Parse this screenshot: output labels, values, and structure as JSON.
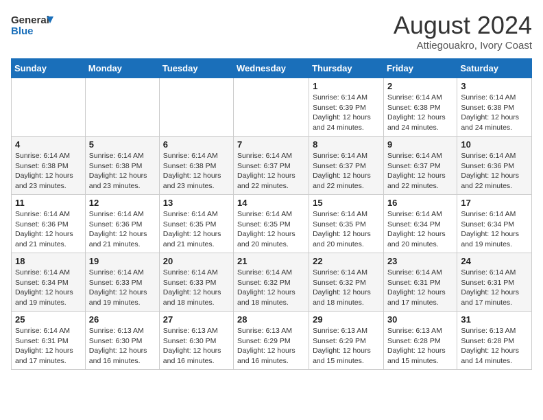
{
  "header": {
    "logo_line1": "General",
    "logo_line2": "Blue",
    "title": "August 2024",
    "subtitle": "Attiegouakro, Ivory Coast"
  },
  "calendar": {
    "days_of_week": [
      "Sunday",
      "Monday",
      "Tuesday",
      "Wednesday",
      "Thursday",
      "Friday",
      "Saturday"
    ],
    "weeks": [
      [
        {
          "day": "",
          "info": ""
        },
        {
          "day": "",
          "info": ""
        },
        {
          "day": "",
          "info": ""
        },
        {
          "day": "",
          "info": ""
        },
        {
          "day": "1",
          "info": "Sunrise: 6:14 AM\nSunset: 6:39 PM\nDaylight: 12 hours and 24 minutes."
        },
        {
          "day": "2",
          "info": "Sunrise: 6:14 AM\nSunset: 6:38 PM\nDaylight: 12 hours and 24 minutes."
        },
        {
          "day": "3",
          "info": "Sunrise: 6:14 AM\nSunset: 6:38 PM\nDaylight: 12 hours and 24 minutes."
        }
      ],
      [
        {
          "day": "4",
          "info": "Sunrise: 6:14 AM\nSunset: 6:38 PM\nDaylight: 12 hours and 23 minutes."
        },
        {
          "day": "5",
          "info": "Sunrise: 6:14 AM\nSunset: 6:38 PM\nDaylight: 12 hours and 23 minutes."
        },
        {
          "day": "6",
          "info": "Sunrise: 6:14 AM\nSunset: 6:38 PM\nDaylight: 12 hours and 23 minutes."
        },
        {
          "day": "7",
          "info": "Sunrise: 6:14 AM\nSunset: 6:37 PM\nDaylight: 12 hours and 22 minutes."
        },
        {
          "day": "8",
          "info": "Sunrise: 6:14 AM\nSunset: 6:37 PM\nDaylight: 12 hours and 22 minutes."
        },
        {
          "day": "9",
          "info": "Sunrise: 6:14 AM\nSunset: 6:37 PM\nDaylight: 12 hours and 22 minutes."
        },
        {
          "day": "10",
          "info": "Sunrise: 6:14 AM\nSunset: 6:36 PM\nDaylight: 12 hours and 22 minutes."
        }
      ],
      [
        {
          "day": "11",
          "info": "Sunrise: 6:14 AM\nSunset: 6:36 PM\nDaylight: 12 hours and 21 minutes."
        },
        {
          "day": "12",
          "info": "Sunrise: 6:14 AM\nSunset: 6:36 PM\nDaylight: 12 hours and 21 minutes."
        },
        {
          "day": "13",
          "info": "Sunrise: 6:14 AM\nSunset: 6:35 PM\nDaylight: 12 hours and 21 minutes."
        },
        {
          "day": "14",
          "info": "Sunrise: 6:14 AM\nSunset: 6:35 PM\nDaylight: 12 hours and 20 minutes."
        },
        {
          "day": "15",
          "info": "Sunrise: 6:14 AM\nSunset: 6:35 PM\nDaylight: 12 hours and 20 minutes."
        },
        {
          "day": "16",
          "info": "Sunrise: 6:14 AM\nSunset: 6:34 PM\nDaylight: 12 hours and 20 minutes."
        },
        {
          "day": "17",
          "info": "Sunrise: 6:14 AM\nSunset: 6:34 PM\nDaylight: 12 hours and 19 minutes."
        }
      ],
      [
        {
          "day": "18",
          "info": "Sunrise: 6:14 AM\nSunset: 6:34 PM\nDaylight: 12 hours and 19 minutes."
        },
        {
          "day": "19",
          "info": "Sunrise: 6:14 AM\nSunset: 6:33 PM\nDaylight: 12 hours and 19 minutes."
        },
        {
          "day": "20",
          "info": "Sunrise: 6:14 AM\nSunset: 6:33 PM\nDaylight: 12 hours and 18 minutes."
        },
        {
          "day": "21",
          "info": "Sunrise: 6:14 AM\nSunset: 6:32 PM\nDaylight: 12 hours and 18 minutes."
        },
        {
          "day": "22",
          "info": "Sunrise: 6:14 AM\nSunset: 6:32 PM\nDaylight: 12 hours and 18 minutes."
        },
        {
          "day": "23",
          "info": "Sunrise: 6:14 AM\nSunset: 6:31 PM\nDaylight: 12 hours and 17 minutes."
        },
        {
          "day": "24",
          "info": "Sunrise: 6:14 AM\nSunset: 6:31 PM\nDaylight: 12 hours and 17 minutes."
        }
      ],
      [
        {
          "day": "25",
          "info": "Sunrise: 6:14 AM\nSunset: 6:31 PM\nDaylight: 12 hours and 17 minutes."
        },
        {
          "day": "26",
          "info": "Sunrise: 6:13 AM\nSunset: 6:30 PM\nDaylight: 12 hours and 16 minutes."
        },
        {
          "day": "27",
          "info": "Sunrise: 6:13 AM\nSunset: 6:30 PM\nDaylight: 12 hours and 16 minutes."
        },
        {
          "day": "28",
          "info": "Sunrise: 6:13 AM\nSunset: 6:29 PM\nDaylight: 12 hours and 16 minutes."
        },
        {
          "day": "29",
          "info": "Sunrise: 6:13 AM\nSunset: 6:29 PM\nDaylight: 12 hours and 15 minutes."
        },
        {
          "day": "30",
          "info": "Sunrise: 6:13 AM\nSunset: 6:28 PM\nDaylight: 12 hours and 15 minutes."
        },
        {
          "day": "31",
          "info": "Sunrise: 6:13 AM\nSunset: 6:28 PM\nDaylight: 12 hours and 14 minutes."
        }
      ]
    ]
  }
}
